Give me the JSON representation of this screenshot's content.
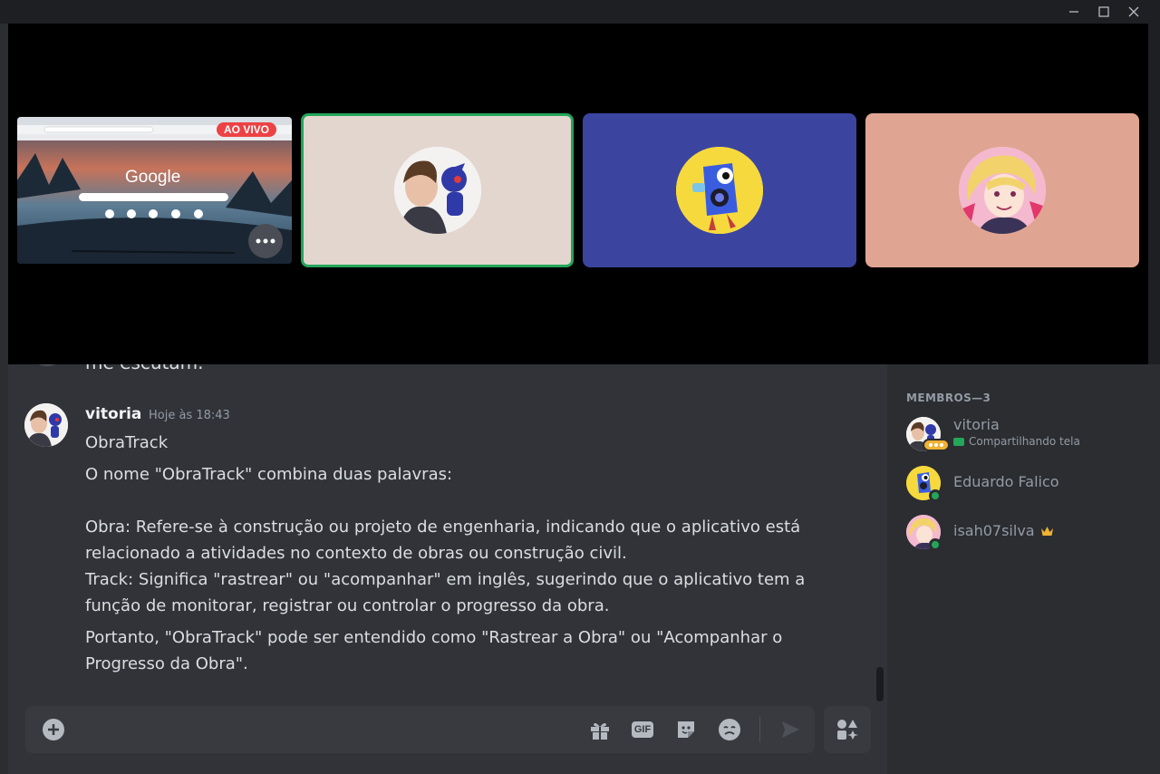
{
  "window": {
    "minimize_icon": "minimize-icon",
    "maximize_icon": "maximize-icon",
    "close_icon": "close-icon"
  },
  "stage": {
    "live_badge": "AO VIVO",
    "screen_share_title": "Google",
    "more_icon": "more-horizontal-icon",
    "tiles": [
      {
        "user": "vitoria",
        "bg": "#e3d6cf",
        "speaking": true
      },
      {
        "user": "Eduardo Falico",
        "bg": "#3b45a0",
        "speaking": false
      },
      {
        "user": "isah07silva",
        "bg": "#e0a592",
        "speaking": false
      }
    ]
  },
  "chat": {
    "previous_text": "me escutam.",
    "message": {
      "author": "vitoria",
      "timestamp": "Hoje às 18:43",
      "lines": [
        "ObraTrack",
        "O nome \"ObraTrack\" combina duas palavras:",
        "Obra: Refere-se à construção ou projeto de engenharia, indicando que o aplicativo está relacionado a atividades no contexto de obras ou construção civil.",
        "Track: Significa \"rastrear\" ou \"acompanhar\" em inglês, sugerindo que o aplicativo tem a função de monitorar, registrar ou controlar o progresso da obra.",
        "Portanto, \"ObraTrack\" pode ser entendido como \"Rastrear a Obra\" ou \"Acompanhar o Progresso da Obra\"."
      ]
    },
    "composer": {
      "add_icon": "plus-circle-icon",
      "gift_icon": "gift-icon",
      "gif_label": "GIF",
      "sticker_icon": "sticker-icon",
      "emoji_icon": "emoji-icon",
      "send_icon": "send-icon",
      "apps_icon": "apps-icon"
    }
  },
  "members": {
    "title": "MEMBROS—3",
    "list": [
      {
        "name": "vitoria",
        "status": "Compartilhando tela",
        "status_icon": "screen-share-icon"
      },
      {
        "name": "Eduardo Falico",
        "status": ""
      },
      {
        "name": "isah07silva",
        "status": "",
        "badge_icon": "crown-icon"
      }
    ]
  },
  "colors": {
    "accent_green": "#23a55a",
    "live_red": "#ed4245",
    "crown": "#f0b232"
  }
}
